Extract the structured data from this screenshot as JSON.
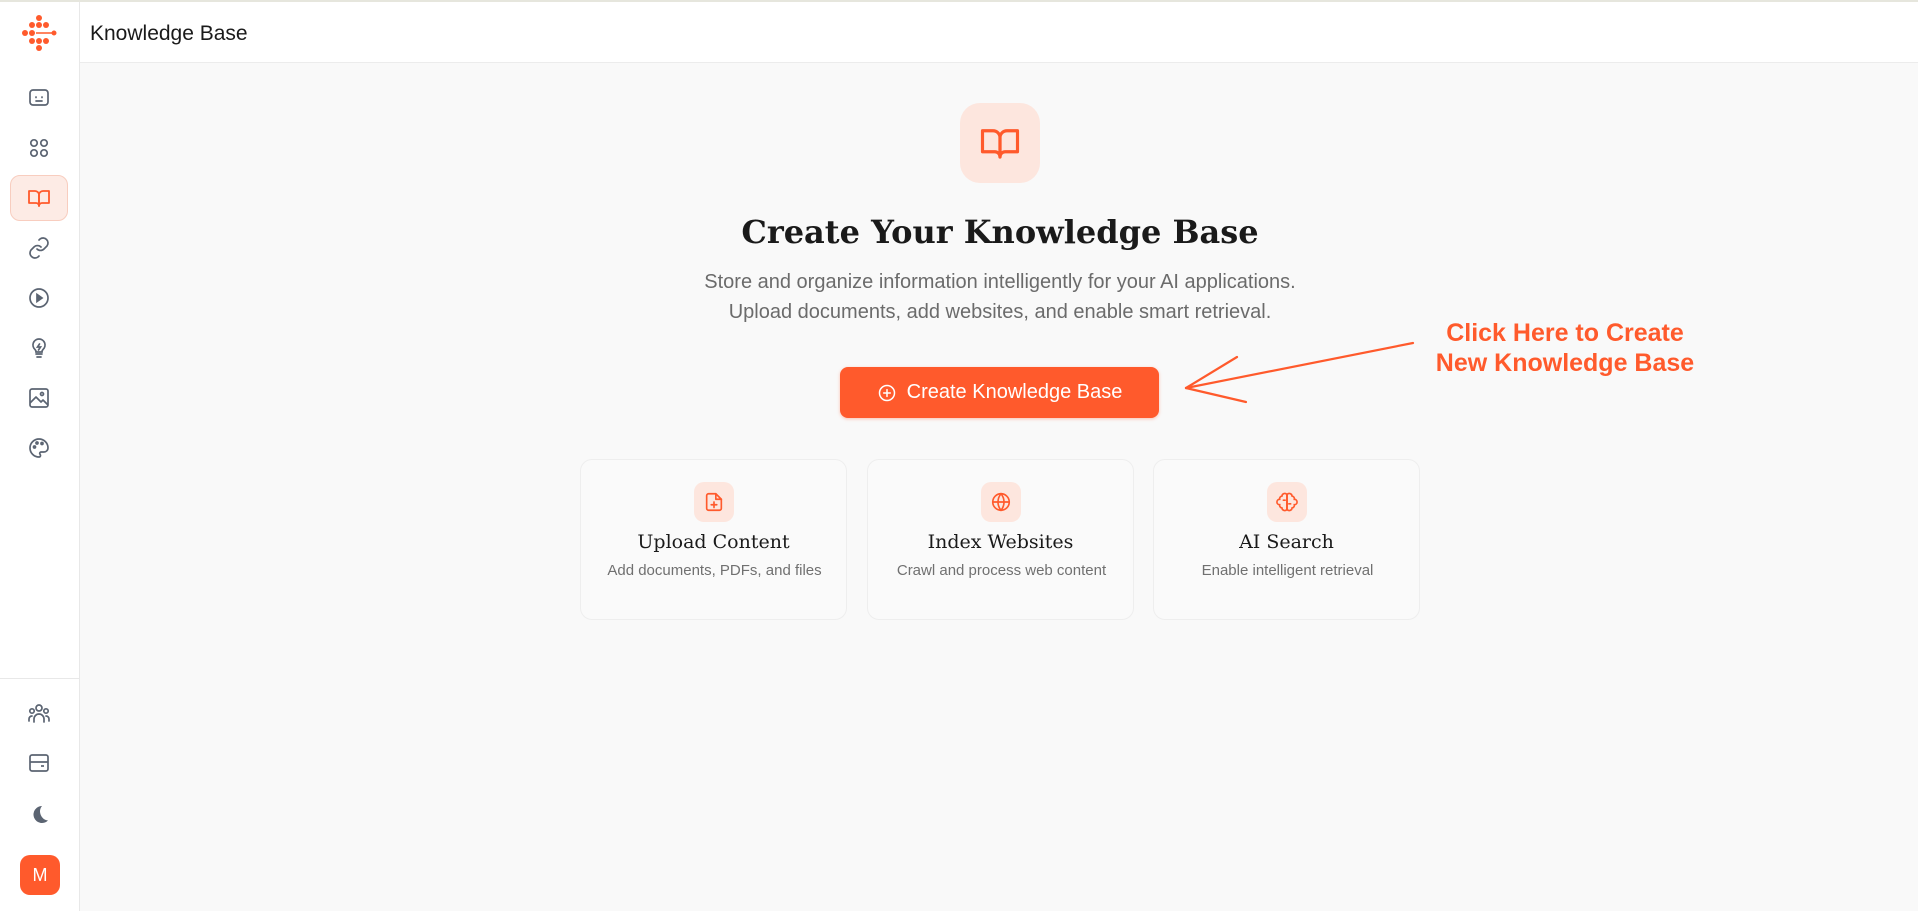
{
  "header": {
    "title": "Knowledge Base"
  },
  "sidebar": {
    "items": [
      {
        "icon": "chat-bot-icon"
      },
      {
        "icon": "apps-grid-icon"
      },
      {
        "icon": "book-open-icon",
        "active": true
      },
      {
        "icon": "link-icon"
      },
      {
        "icon": "play-circle-icon"
      },
      {
        "icon": "lightbulb-icon"
      },
      {
        "icon": "image-icon"
      },
      {
        "icon": "palette-icon"
      }
    ],
    "bottom_items": [
      {
        "icon": "team-icon"
      },
      {
        "icon": "billing-card-icon"
      },
      {
        "icon": "moon-icon"
      }
    ],
    "avatar_initial": "M"
  },
  "main": {
    "title": "Create Your Knowledge Base",
    "subtitle_line1": "Store and organize information intelligently for your AI applications.",
    "subtitle_line2": "Upload documents, add websites, and enable smart retrieval.",
    "create_button_label": "Create Knowledge Base",
    "annotation_line1": "Click Here to Create",
    "annotation_line2": "New Knowledge Base",
    "features": [
      {
        "title": "Upload Content",
        "desc": "Add documents, PDFs, and files",
        "icon": "file-plus-icon"
      },
      {
        "title": "Index Websites",
        "desc": "Crawl and process web content",
        "icon": "globe-icon"
      },
      {
        "title": "AI Search",
        "desc": "Enable intelligent retrieval",
        "icon": "brain-icon"
      }
    ]
  },
  "colors": {
    "accent": "#ff5a2c",
    "accent_soft": "#fde6de",
    "icon_gray": "#5b6472"
  }
}
